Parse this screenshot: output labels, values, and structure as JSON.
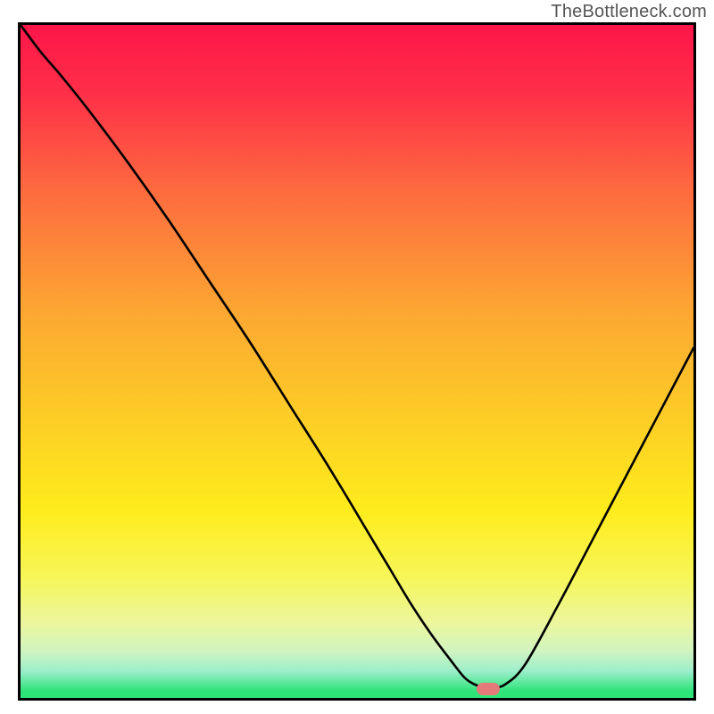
{
  "watermark": "TheBottleneck.com",
  "colors": {
    "gradient_top": "#fd1649",
    "gradient_bottom": "#2ee479",
    "curve": "#000000",
    "marker": "#e47a7a",
    "frame": "#000000"
  },
  "chart_data": {
    "type": "line",
    "title": "",
    "xlabel": "",
    "ylabel": "",
    "xlim": [
      0,
      100
    ],
    "ylim": [
      0,
      100
    ],
    "grid": false,
    "legend": false,
    "note": "Axes are normalized 0–100 because no ticks or labels are visible. y=0 is the bottom (green) edge, y=100 is the top (red) edge. The curve traces the black line; the marker sits at the curve's minimum.",
    "series": [
      {
        "name": "curve",
        "x": [
          0.0,
          3.0,
          6.0,
          10.0,
          16.0,
          22.0,
          28.0,
          34.0,
          40.0,
          46.0,
          52.0,
          55.0,
          58.0,
          61.0,
          64.0,
          66.0,
          67.5,
          69.0,
          70.0,
          72.0,
          75.0,
          80.0,
          85.0,
          90.0,
          95.0,
          100.0
        ],
        "y": [
          100.0,
          96.0,
          92.5,
          87.5,
          79.5,
          71.0,
          62.0,
          53.0,
          43.5,
          34.0,
          24.0,
          19.0,
          14.0,
          9.5,
          5.5,
          3.0,
          2.0,
          1.5,
          1.5,
          2.0,
          5.0,
          14.0,
          23.5,
          33.0,
          42.5,
          52.0
        ]
      }
    ],
    "markers": [
      {
        "name": "min-marker",
        "x": 69.5,
        "y": 1.3,
        "shape": "pill",
        "fill": "#e47a7a"
      }
    ]
  }
}
